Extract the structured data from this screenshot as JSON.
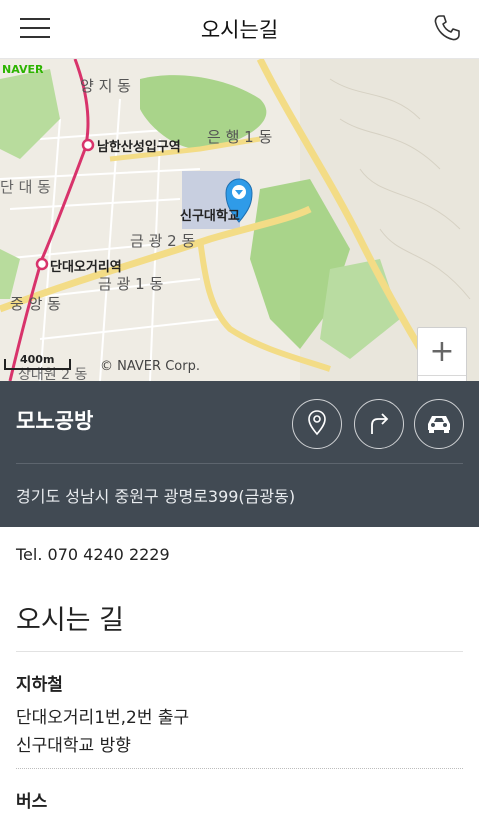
{
  "header": {
    "title": "오시는길",
    "menu_icon": "hamburger-menu-icon",
    "phone_icon": "phone-icon"
  },
  "map": {
    "brand": "NAVER",
    "copyright": "© NAVER Corp.",
    "scale_label": "400m",
    "labels": {
      "yangji": "양 지 동",
      "namhansanseong": "남한산성입구역",
      "eunhaeng": "은 행 1 동",
      "dandae": "단 대 동",
      "singu": "신구대학교",
      "geumgwang2": "금 광 2 동",
      "dandaeogeori": "단대오거리역",
      "geumgwang1": "금 광 1 동",
      "jungang": "중 앙 동",
      "sangdaewon": "상대원 2 동"
    },
    "zoom_in": "+",
    "zoom_out": "−",
    "colors": {
      "park": "#a9d48a",
      "road": "#f7e8a0",
      "subway": "#d8336b",
      "pin": "#2f9be8"
    }
  },
  "place": {
    "name": "모노공방",
    "address": "경기도 성남시 중원구 광명로399(금광동)",
    "actions": [
      "location-pin-icon",
      "directions-icon",
      "car-icon"
    ]
  },
  "contact": {
    "tel": "Tel. 070 4240 2229"
  },
  "directions": {
    "title": "오시는 길",
    "subway_label": "지하철",
    "subway_line1": "단대오거리1번,2번 출구",
    "subway_line2": "신구대학교 방향",
    "bus_label": "버스"
  }
}
